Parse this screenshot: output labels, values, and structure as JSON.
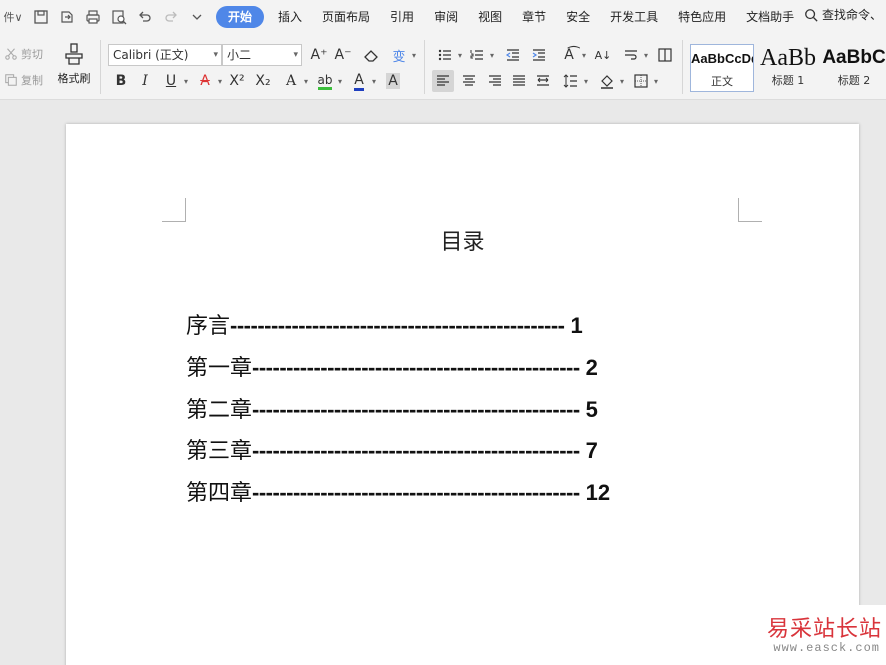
{
  "menubar": {
    "edge_label": "件",
    "tabs": [
      {
        "label": "开始",
        "active": true
      },
      {
        "label": "插入"
      },
      {
        "label": "页面布局"
      },
      {
        "label": "引用"
      },
      {
        "label": "审阅"
      },
      {
        "label": "视图"
      },
      {
        "label": "章节"
      },
      {
        "label": "安全"
      },
      {
        "label": "开发工具"
      },
      {
        "label": "特色应用"
      },
      {
        "label": "文档助手"
      }
    ],
    "search_label": "查找命令、"
  },
  "ribbon": {
    "cut_label": "剪切",
    "copy_label": "复制",
    "format_brush_label": "格式刷",
    "font_name": "Calibri (正文)",
    "font_size": "小二",
    "styles": [
      {
        "sample": "AaBbCcDd",
        "name": "正文"
      },
      {
        "sample": "AaBb",
        "name": "标题 1"
      },
      {
        "sample": "AaBbC",
        "name": "标题 2"
      }
    ],
    "accent_color": "#4f87e8"
  },
  "document": {
    "title": "目录",
    "toc": [
      {
        "label": "序言",
        "dots": "-------------------------------------------------",
        "page": "1"
      },
      {
        "label": "第一章",
        "dots": "------------------------------------------------",
        "page": "2"
      },
      {
        "label": "第二章",
        "dots": "------------------------------------------------",
        "page": "5"
      },
      {
        "label": "第三章",
        "dots": "------------------------------------------------",
        "page": "7"
      },
      {
        "label": "第四章",
        "dots": "------------------------------------------------",
        "page": "12"
      }
    ]
  },
  "watermark": {
    "text": "易采站长站",
    "url": "www.easck.com"
  }
}
